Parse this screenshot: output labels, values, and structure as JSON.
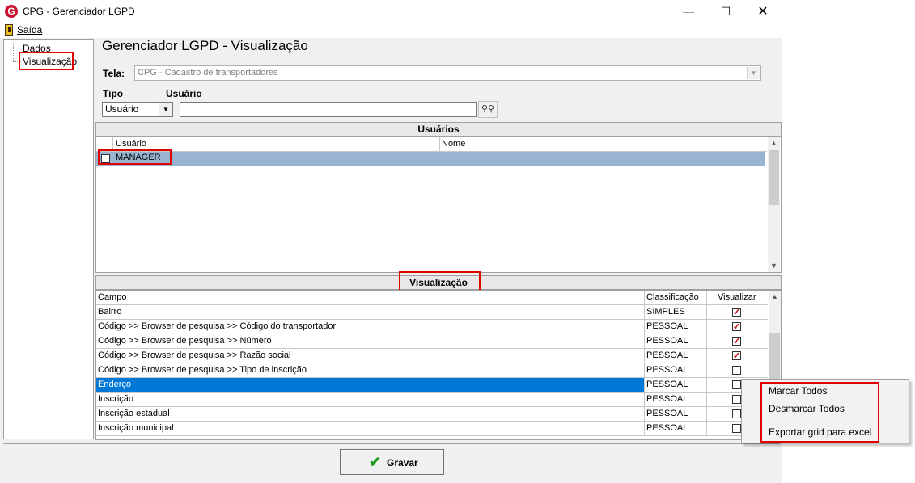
{
  "window": {
    "title": "CPG - Gerenciador LGPD",
    "logo_letter": "G",
    "minimize": "—",
    "maximize": "☐",
    "close": "✕"
  },
  "menu": {
    "exit_label": "Saída"
  },
  "tree": {
    "items": [
      {
        "label": "Dados"
      },
      {
        "label": "Visualização"
      }
    ]
  },
  "main": {
    "title": "Gerenciador LGPD - Visualização",
    "tela_label": "Tela:",
    "tela_value": "CPG - Cadastro de transportadores",
    "tipo_label": "Tipo",
    "usuario_label": "Usuário",
    "tipo_value": "Usuário",
    "usuario_value": ""
  },
  "users_panel": {
    "header": "Usuários",
    "columns": [
      "Usuário",
      "Nome"
    ],
    "rows": [
      {
        "checked": false,
        "usuario": "MANAGER",
        "nome": ""
      }
    ]
  },
  "visualizacao_panel": {
    "header": "Visualização",
    "columns": [
      "Campo",
      "Classificação",
      "Visualizar"
    ],
    "rows": [
      {
        "campo": "Bairro",
        "classificacao": "SIMPLES",
        "visualizar": true
      },
      {
        "campo": "Código >> Browser de pesquisa >> Código do transportador",
        "classificacao": "PESSOAL",
        "visualizar": true
      },
      {
        "campo": "Código >> Browser de pesquisa >> Número",
        "classificacao": "PESSOAL",
        "visualizar": true
      },
      {
        "campo": "Código >> Browser de pesquisa >> Razão social",
        "classificacao": "PESSOAL",
        "visualizar": true
      },
      {
        "campo": "Código >> Browser de pesquisa >> Tipo de inscrição",
        "classificacao": "PESSOAL",
        "visualizar": false
      },
      {
        "campo": "Enderço",
        "classificacao": "PESSOAL",
        "visualizar": false,
        "selected": true
      },
      {
        "campo": "Inscrição",
        "classificacao": "PESSOAL",
        "visualizar": false
      },
      {
        "campo": "Inscrição estadual",
        "classificacao": "PESSOAL",
        "visualizar": false
      },
      {
        "campo": "Inscrição municipal",
        "classificacao": "PESSOAL",
        "visualizar": false
      }
    ]
  },
  "footer": {
    "save_label": "Gravar"
  },
  "context_menu": {
    "items": [
      {
        "label": "Marcar Todos"
      },
      {
        "label": "Desmarcar Todos"
      },
      {
        "label": "Exportar grid para excel"
      }
    ]
  },
  "colors": {
    "selection": "#0078d7",
    "user_row_selection": "#99b4d1",
    "highlight_box": "#e00000",
    "check_mark": "#c00000",
    "save_icon": "#1a9a1a"
  }
}
